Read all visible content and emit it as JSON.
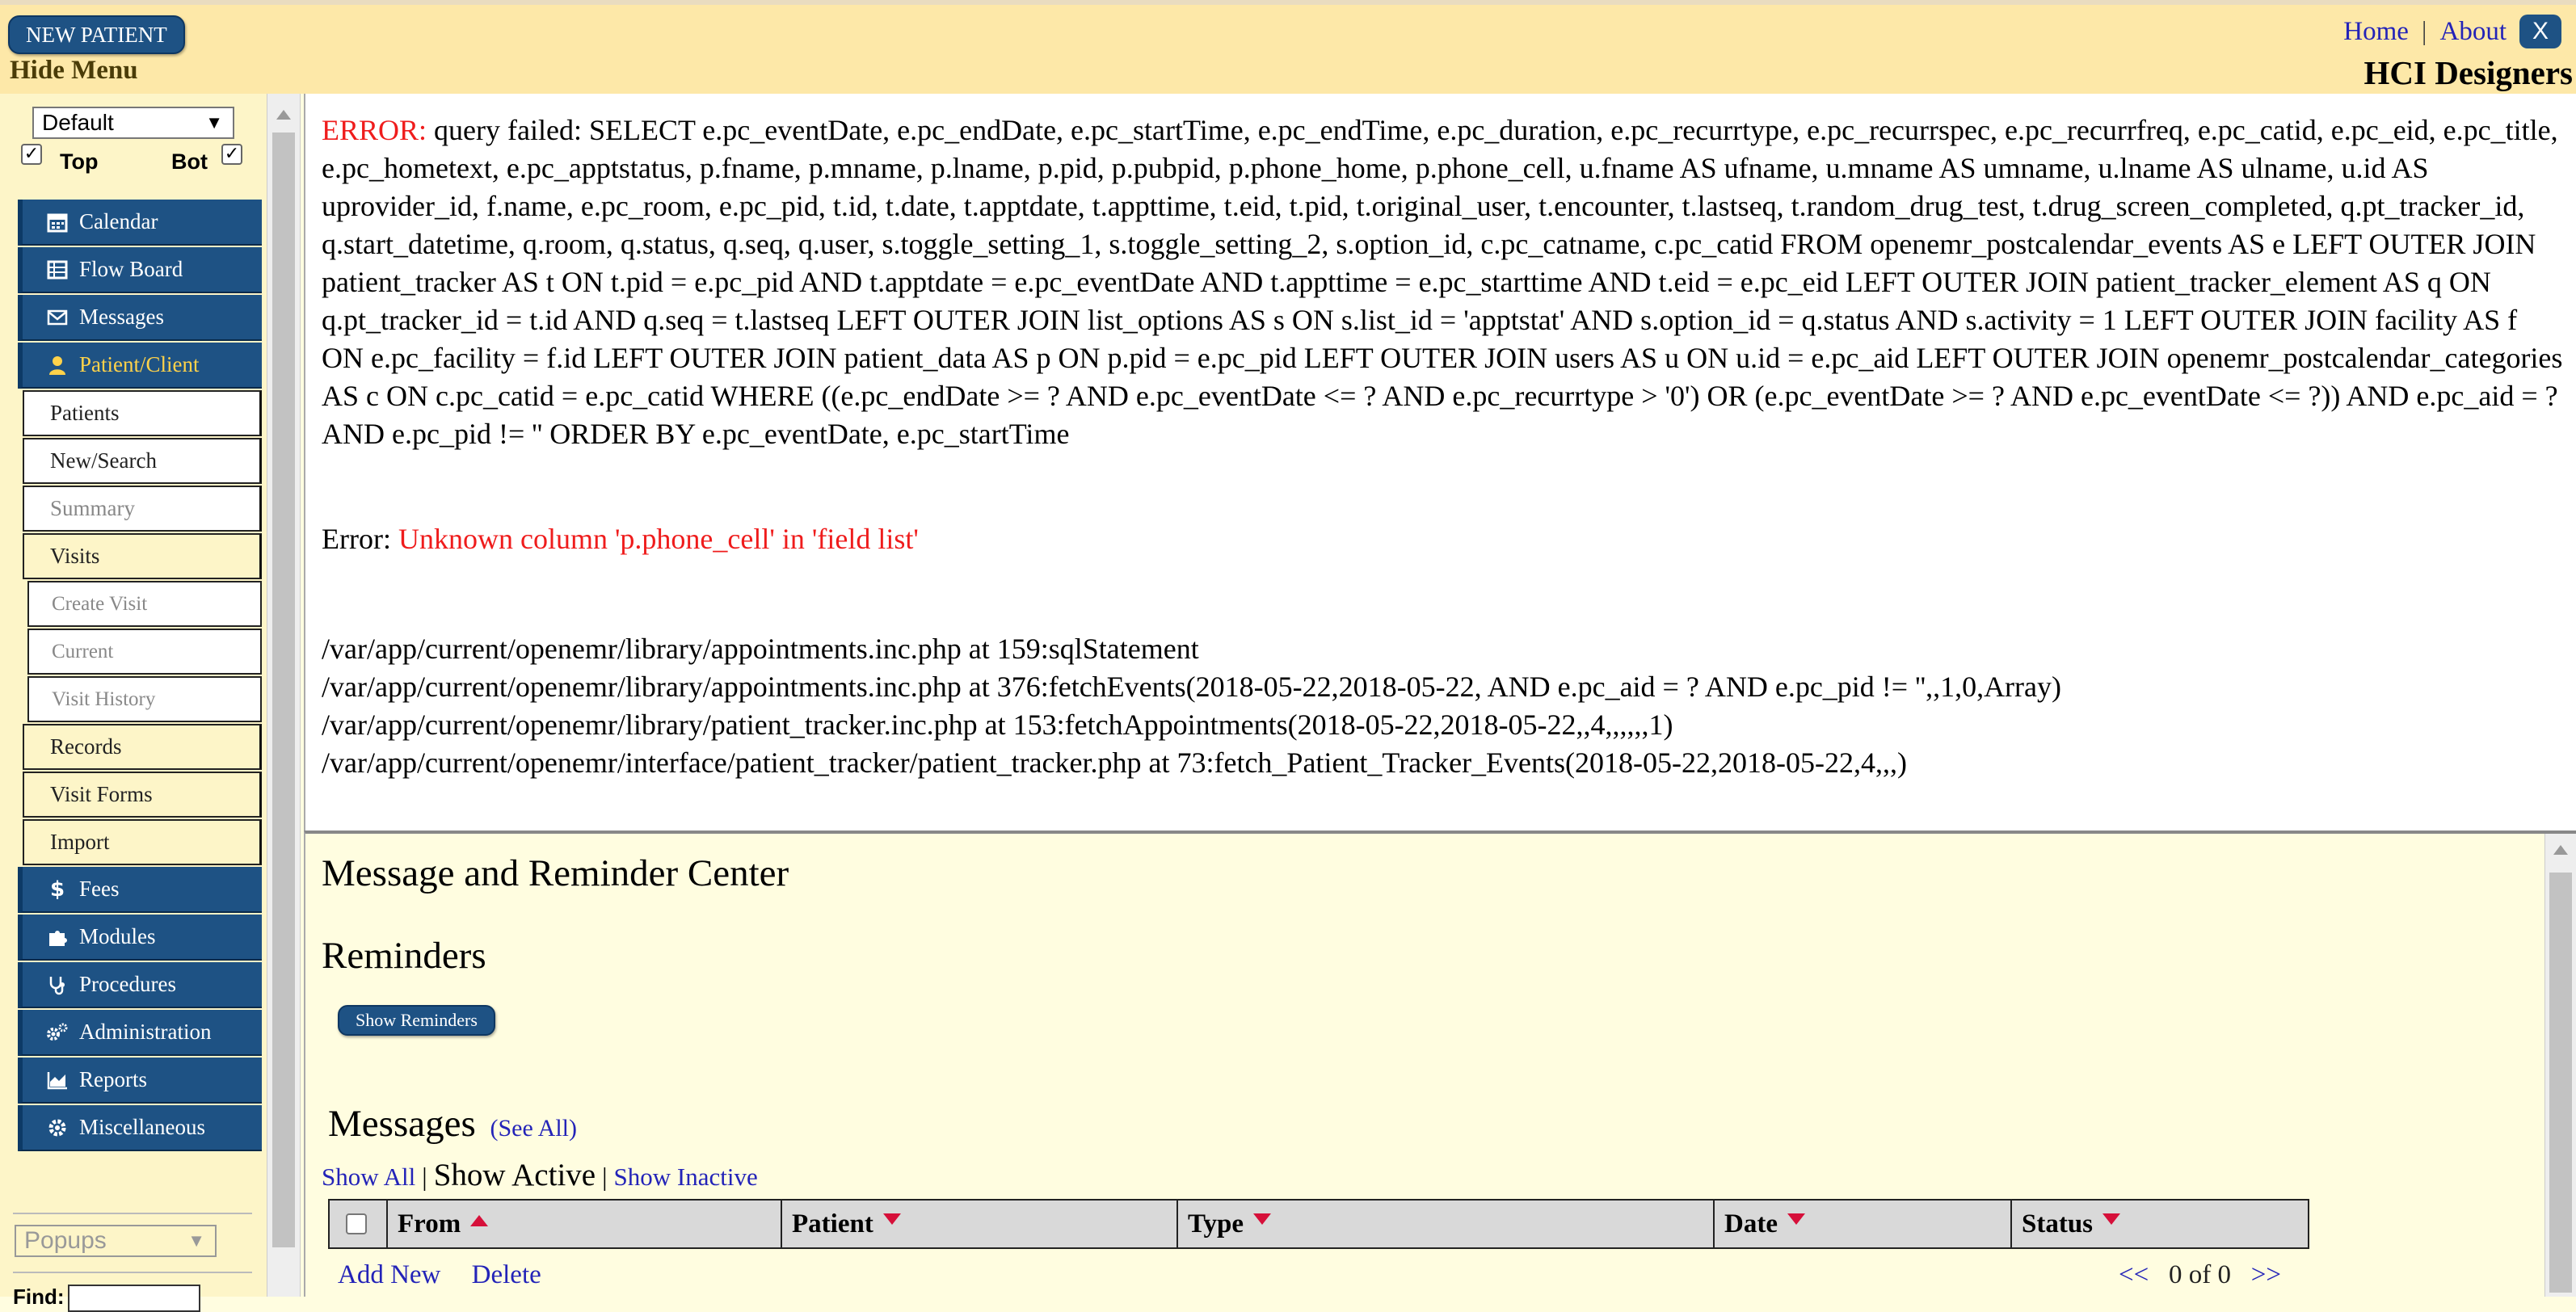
{
  "header": {
    "new_patient": "NEW PATIENT",
    "hide_menu": "Hide Menu",
    "home": "Home",
    "separator": "|",
    "about": "About",
    "close": "X",
    "brand": "HCI Designers"
  },
  "sidebar": {
    "layout_select": "Default",
    "top_label": "Top",
    "bot_label": "Bot",
    "items": [
      {
        "label": "Calendar",
        "icon": "calendar-icon"
      },
      {
        "label": "Flow Board",
        "icon": "flow-board-icon"
      },
      {
        "label": "Messages",
        "icon": "envelope-icon"
      },
      {
        "label": "Patient/Client",
        "icon": "user-icon"
      },
      {
        "label": "Patients"
      },
      {
        "label": "New/Search"
      },
      {
        "label": "Summary"
      },
      {
        "label": "Visits"
      },
      {
        "label": "Create Visit"
      },
      {
        "label": "Current"
      },
      {
        "label": "Visit History"
      },
      {
        "label": "Records"
      },
      {
        "label": "Visit Forms"
      },
      {
        "label": "Import"
      },
      {
        "label": "Fees",
        "icon": "dollar-icon"
      },
      {
        "label": "Modules",
        "icon": "puzzle-icon"
      },
      {
        "label": "Procedures",
        "icon": "stethoscope-icon"
      },
      {
        "label": "Administration",
        "icon": "gears-icon"
      },
      {
        "label": "Reports",
        "icon": "chart-icon"
      },
      {
        "label": "Miscellaneous",
        "icon": "gear-icon"
      }
    ],
    "popups": "Popups",
    "find_label": "Find:"
  },
  "error": {
    "label": "ERROR:",
    "query": "query failed: SELECT e.pc_eventDate, e.pc_endDate, e.pc_startTime, e.pc_endTime, e.pc_duration, e.pc_recurrtype, e.pc_recurrspec, e.pc_recurrfreq, e.pc_catid, e.pc_eid, e.pc_title, e.pc_hometext, e.pc_apptstatus, p.fname, p.mname, p.lname, p.pid, p.pubpid, p.phone_home, p.phone_cell, u.fname AS ufname, u.mname AS umname, u.lname AS ulname, u.id AS uprovider_id, f.name, e.pc_room, e.pc_pid, t.id, t.date, t.apptdate, t.appttime, t.eid, t.pid, t.original_user, t.encounter, t.lastseq, t.random_drug_test, t.drug_screen_completed, q.pt_tracker_id, q.start_datetime, q.room, q.status, q.seq, q.user, s.toggle_setting_1, s.toggle_setting_2, s.option_id, c.pc_catname, c.pc_catid FROM openemr_postcalendar_events AS e LEFT OUTER JOIN patient_tracker AS t ON t.pid = e.pc_pid AND t.apptdate = e.pc_eventDate AND t.appttime = e.pc_starttime AND t.eid = e.pc_eid LEFT OUTER JOIN patient_tracker_element AS q ON q.pt_tracker_id = t.id AND q.seq = t.lastseq LEFT OUTER JOIN list_options AS s ON s.list_id = 'apptstat' AND s.option_id = q.status AND s.activity = 1 LEFT OUTER JOIN facility AS f ON e.pc_facility = f.id LEFT OUTER JOIN patient_data AS p ON p.pid = e.pc_pid LEFT OUTER JOIN users AS u ON u.id = e.pc_aid LEFT OUTER JOIN openemr_postcalendar_categories AS c ON c.pc_catid = e.pc_catid WHERE ((e.pc_endDate >= ? AND e.pc_eventDate <= ? AND e.pc_recurrtype > '0') OR (e.pc_eventDate >= ? AND e.pc_eventDate <= ?)) AND e.pc_aid = ? AND e.pc_pid != '' ORDER BY e.pc_eventDate, e.pc_startTime",
    "error_label": "Error:",
    "error_message": "Unknown column 'p.phone_cell' in 'field list'",
    "trace": [
      "/var/app/current/openemr/library/appointments.inc.php at 159:sqlStatement",
      "/var/app/current/openemr/library/appointments.inc.php at 376:fetchEvents(2018-05-22,2018-05-22, AND e.pc_aid = ? AND e.pc_pid != '',,1,0,Array)",
      "/var/app/current/openemr/library/patient_tracker.inc.php at 153:fetchAppointments(2018-05-22,2018-05-22,,4,,,,,,1)",
      "/var/app/current/openemr/interface/patient_tracker/patient_tracker.php at 73:fetch_Patient_Tracker_Events(2018-05-22,2018-05-22,4,,,)"
    ]
  },
  "messages": {
    "center_title": "Message and Reminder Center",
    "reminders_title": "Reminders",
    "show_reminders": "Show Reminders",
    "messages_title": "Messages",
    "see_all": "(See All)",
    "filter_all": "Show All",
    "filter_sep": "|",
    "filter_active": "Show Active",
    "filter_inactive": "Show Inactive",
    "columns": [
      "From",
      "Patient",
      "Type",
      "Date",
      "Status"
    ],
    "add_new": "Add New",
    "delete": "Delete",
    "pager_prev": "<<",
    "pager_text": "0 of 0",
    "pager_next": ">>"
  }
}
